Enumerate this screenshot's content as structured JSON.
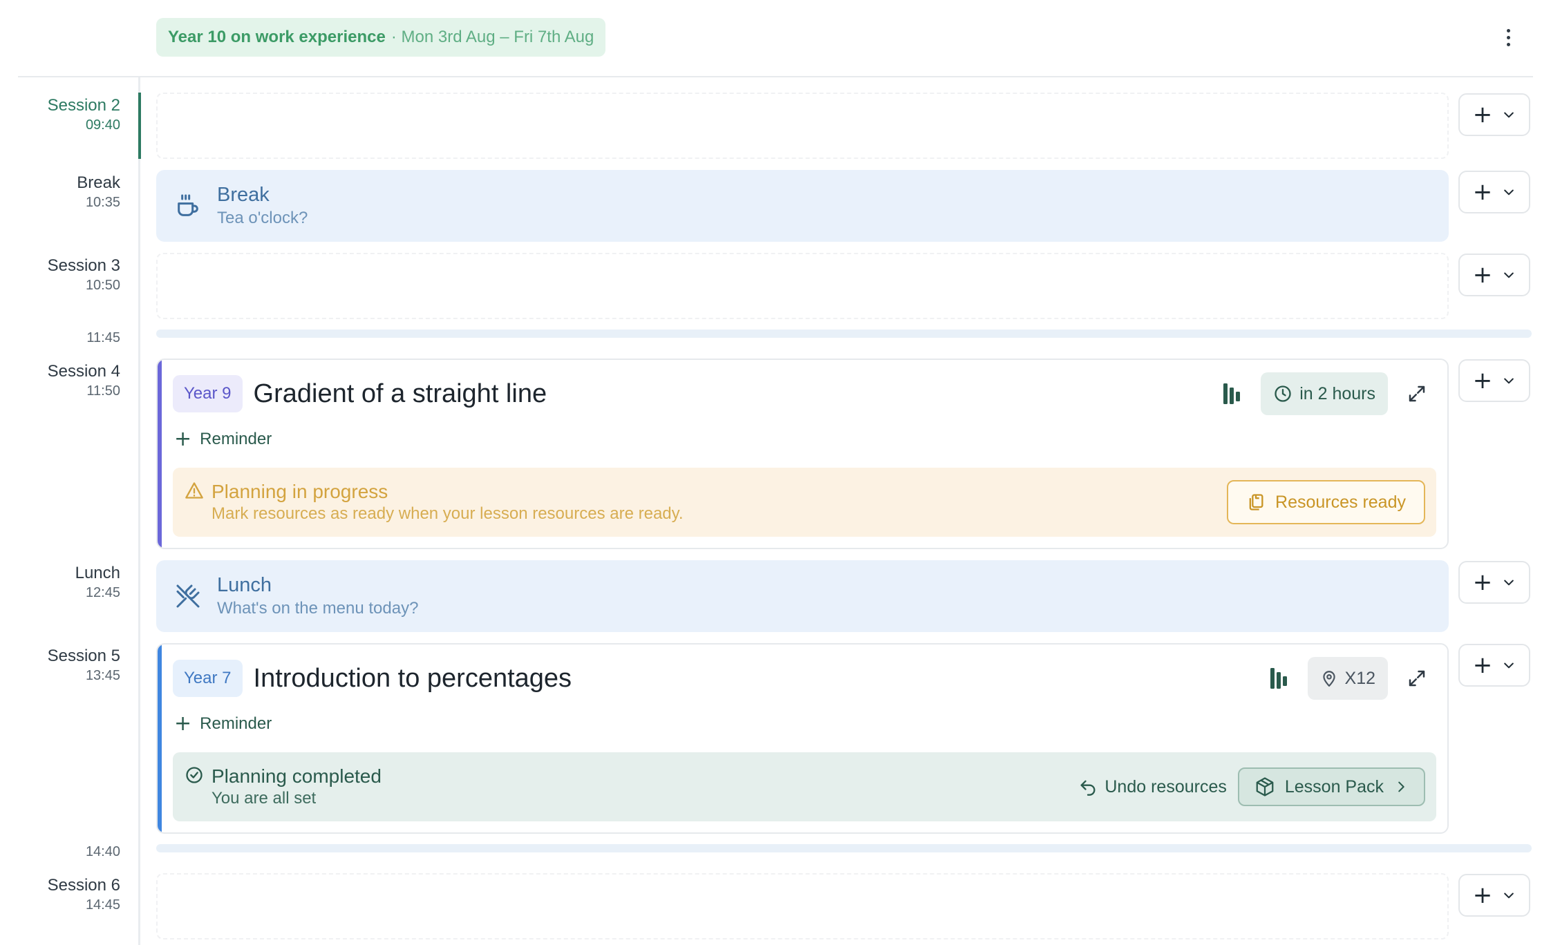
{
  "header": {
    "banner_title": "Year 10 on work experience",
    "banner_dates": "· Mon 3rd Aug – Fri 7th Aug",
    "more_icon": "more-vertical-icon"
  },
  "slots": [
    {
      "name": "Session 2",
      "time": "09:40",
      "active": true
    },
    {
      "name": "Break",
      "time": "10:35"
    },
    {
      "name": "Session 3",
      "time": "10:50"
    },
    {
      "time": "11:45"
    },
    {
      "name": "Session 4",
      "time": "11:50"
    },
    {
      "name": "Lunch",
      "time": "12:45"
    },
    {
      "name": "Session 5",
      "time": "13:45"
    },
    {
      "time": "14:40"
    },
    {
      "name": "Session 6",
      "time": "14:45"
    }
  ],
  "break_card": {
    "title": "Break",
    "subtitle": "Tea o'clock?",
    "icon": "coffee-cup-icon"
  },
  "lunch_card": {
    "title": "Lunch",
    "subtitle": "What's on the menu today?",
    "icon": "utensils-crossed-icon"
  },
  "lesson1": {
    "year": "Year 9",
    "title": "Gradient of a straight line",
    "chip": "in 2 hours",
    "reminder": "Reminder",
    "status_title": "Planning in progress",
    "status_sub": "Mark resources as ready when your lesson resources are ready.",
    "action": "Resources ready",
    "colors": {
      "accent": "#6b67d9",
      "pill_bg": "#ecebfb",
      "pill_text": "#5b57c9"
    }
  },
  "lesson2": {
    "year": "Year 7",
    "title": "Introduction to percentages",
    "chip": "X12",
    "reminder": "Reminder",
    "status_title": "Planning completed",
    "status_sub": "You are all set",
    "undo": "Undo resources",
    "action": "Lesson Pack",
    "colors": {
      "accent": "#3f86e0",
      "pill_bg": "#e6f0fc",
      "pill_text": "#3f78c2"
    }
  },
  "colors": {
    "brand_green": "#2d7a62",
    "banner_bg": "#e3f4ea",
    "info_bg": "#e9f1fb",
    "warn_bg": "#fcf2e3",
    "warn_text": "#d3a33f",
    "done_bg": "#e5efec"
  }
}
